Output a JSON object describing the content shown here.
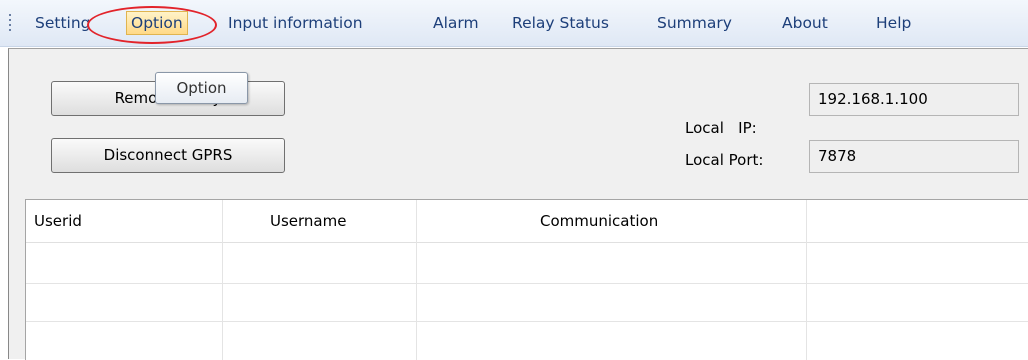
{
  "menu": {
    "items": [
      "Setting",
      "Option",
      "Input information",
      "Alarm",
      "Relay Status",
      "Summary",
      "About",
      "Help"
    ],
    "active": "Option"
  },
  "tooltip": "Option",
  "buttons": {
    "remove": "Remove Relay",
    "disconnect": "Disconnect GPRS"
  },
  "local_ip": {
    "label": "Local   IP:",
    "value": "192.168.1.100"
  },
  "local_port": {
    "label": "Local Port:",
    "value": "7878"
  },
  "table": {
    "columns": [
      "Userid",
      "Username",
      "Communication",
      ""
    ],
    "rows": [
      [
        "",
        "",
        "",
        ""
      ],
      [
        "",
        "",
        "",
        ""
      ],
      [
        "",
        "",
        "",
        ""
      ]
    ]
  },
  "colors": {
    "annotation": "#e2232a",
    "menu_text": "#1d3f7a",
    "active_menu_bg": "#ffd987"
  }
}
